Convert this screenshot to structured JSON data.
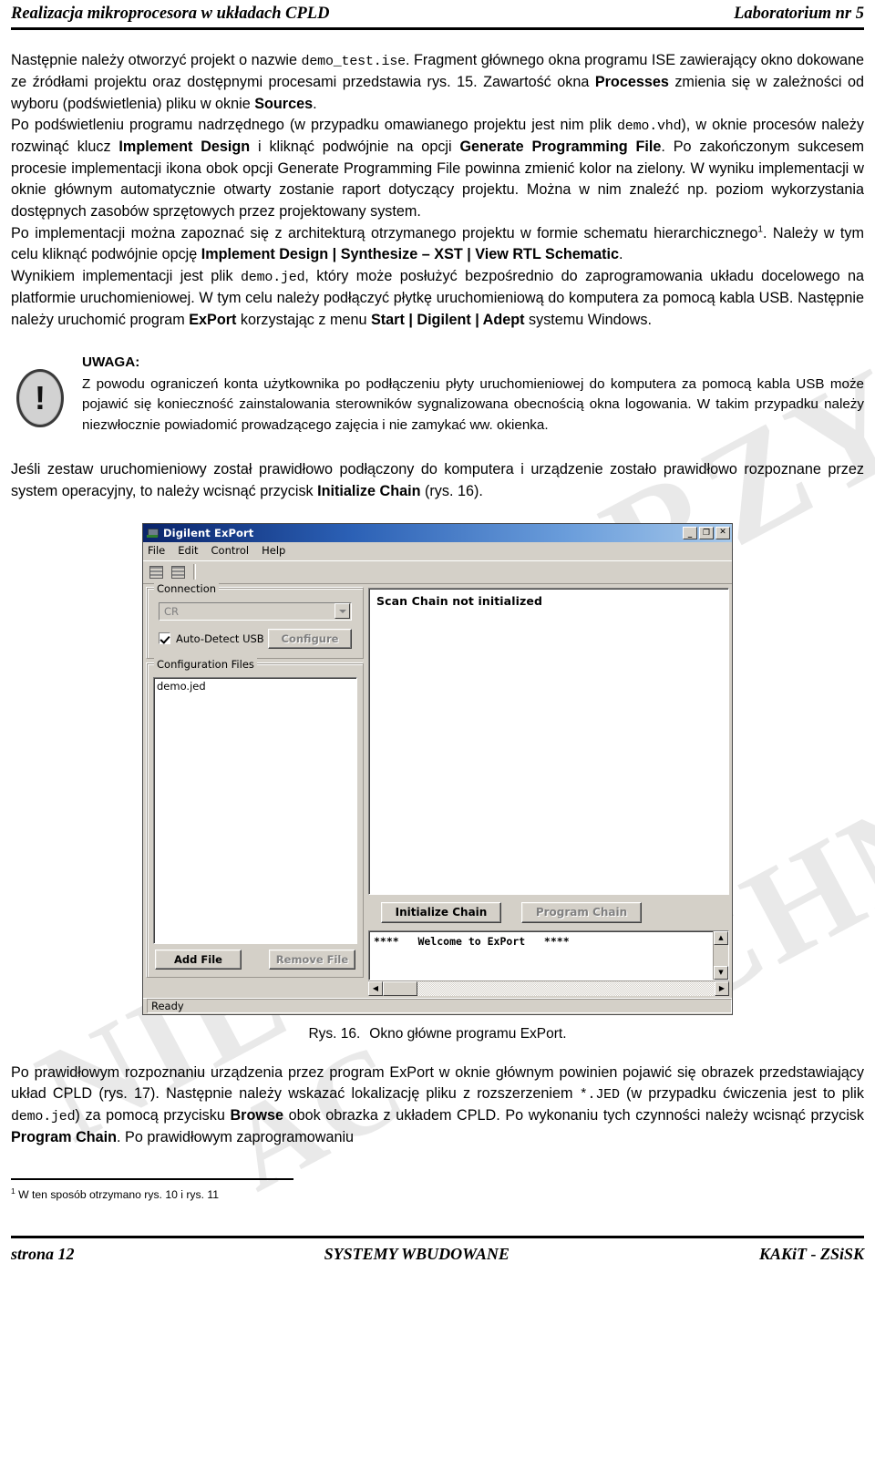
{
  "header": {
    "left": "Realizacja mikroprocesora w układach CPLD",
    "right": "Laboratorium nr 5"
  },
  "body": {
    "p1_a": "Następnie należy otworzyć projekt o nazwie ",
    "p1_code1": "demo_test.ise",
    "p1_b": ". Fragment głównego okna programu ISE zawierający okno dokowane ze źródłami projektu oraz dostępnymi procesami przedstawia rys. 15. Zawartość okna ",
    "p1_bold1": "Processes",
    "p1_c": " zmienia się w zależności od wyboru (podświetlenia) pliku w oknie ",
    "p1_bold2": "Sources",
    "p1_d": ".",
    "p2_a": "Po podświetleniu programu nadrzędnego (w przypadku omawianego projektu jest nim plik ",
    "p2_code1": "demo.vhd",
    "p2_b": "), w oknie procesów należy rozwinąć klucz ",
    "p2_bold1": "Implement Design",
    "p2_c": " i kliknąć podwójnie na opcji ",
    "p2_bold2": "Generate Programming File",
    "p2_d": ". Po zakończonym sukcesem procesie implementacji ikona obok opcji Generate Programming File powinna zmienić kolor na zielony. W wyniku implementacji w oknie głównym automatycznie otwarty zostanie raport dotyczący projektu. Można w nim znaleźć np. poziom wykorzystania dostępnych zasobów sprzętowych przez projektowany system.",
    "p3_a": "Po implementacji można zapoznać się z architekturą otrzymanego projektu w formie schematu hierarchicznego",
    "p3_sup": "1",
    "p3_b": ". Należy w tym celu kliknąć podwójnie opcję ",
    "p3_bold1": "Implement Design | Synthesize – XST | View RTL Schematic",
    "p3_c": ".",
    "p4_a": "Wynikiem implementacji jest plik ",
    "p4_code1": "demo.jed",
    "p4_b": ", który może posłużyć bezpośrednio do zaprogramowania układu docelowego na platformie uruchomieniowej. W tym celu należy podłączyć płytkę uruchomieniową do komputera za pomocą kabla USB. Następnie należy uruchomić program ",
    "p4_bold1": "ExPort",
    "p4_c": " korzystając z menu ",
    "p4_bold2": "Start | Digilent | Adept",
    "p4_d": " systemu Windows."
  },
  "note": {
    "icon_glyph": "!",
    "title": "UWAGA:",
    "text": "Z powodu ograniczeń konta użytkownika po podłączeniu płyty uruchomieniowej do komputera za pomocą kabla USB może pojawić się konieczność zainstalowania sterowników sygnalizowana obecnością okna logowania. W takim przypadku należy niezwłocznie powiadomić prowadzącego zajęcia i nie zamykać ww. okienka."
  },
  "after_note": {
    "a": "Jeśli zestaw uruchomieniowy został prawidłowo podłączony do komputera i urządzenie zostało prawidłowo rozpoznane przez system operacyjny, to należy wcisnąć przycisk ",
    "bold1": "Initialize Chain",
    "b": " (rys. 16)."
  },
  "window": {
    "title": "Digilent ExPort",
    "title_buttons": {
      "minimize": "_",
      "maximize": "❐",
      "close": "✕"
    },
    "menu": [
      "File",
      "Edit",
      "Control",
      "Help"
    ],
    "connection": {
      "group_label": "Connection",
      "combo_value": "CR",
      "checkbox_label": "Auto-Detect USB",
      "checkbox_checked": true,
      "configure_label": "Configure",
      "configure_enabled": false
    },
    "configuration_files": {
      "group_label": "Configuration Files",
      "files": [
        "demo.jed"
      ],
      "add_label": "Add File",
      "add_enabled": true,
      "remove_label": "Remove File",
      "remove_enabled": false
    },
    "scan": {
      "message": "Scan Chain not initialized",
      "initialize_label": "Initialize Chain",
      "initialize_enabled": true,
      "program_label": "Program Chain",
      "program_enabled": false
    },
    "console": {
      "line": "****   Welcome to ExPort   ****"
    },
    "statusbar": {
      "text": "Ready"
    }
  },
  "figure": {
    "number": "Rys. 16.",
    "caption": "Okno główne programu ExPort."
  },
  "bottom": {
    "a": "Po prawidłowym rozpoznaniu urządzenia przez program ExPort w oknie głównym powinien pojawić się obrazek przedstawiający układ CPLD (rys. 17). Następnie należy wskazać lokalizację pliku z rozszerzeniem ",
    "code1": "*.JED",
    "b": " (w przypadku ćwiczenia jest to plik ",
    "code2": "demo.jed",
    "c": ") za pomocą przycisku ",
    "bold1": "Browse",
    "d": " obok obrazka z układem CPLD. Po wykonaniu tych czynności należy wcisnąć przycisk ",
    "bold2": "Program Chain",
    "e": ". Po prawidłowym zaprogramowaniu"
  },
  "footnote": {
    "marker": "1",
    "text": " W ten sposób otrzymano rys. 10 i rys. 11"
  },
  "footer": {
    "left": "strona 12",
    "center": "SYSTEMY WBUDOWANE",
    "right": "KAKiT - ZSiSK"
  },
  "watermark": {
    "w1": "NIE",
    "w2": "PRZY",
    "w3": "CHNIA",
    "w4": "AC"
  },
  "colors": {
    "titlebar_start": "#0a246a",
    "titlebar_end": "#a6c8ea",
    "window_face": "#d4d0c8",
    "disabled_text": "#808080"
  }
}
